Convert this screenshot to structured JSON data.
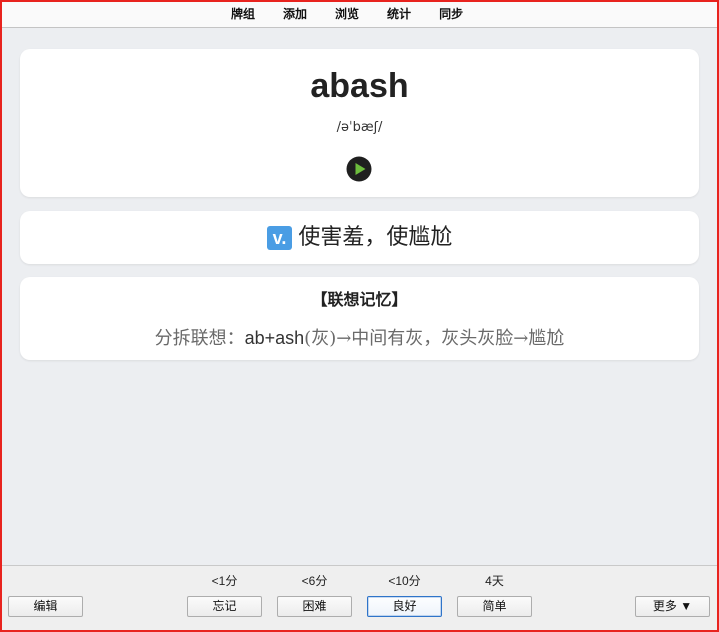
{
  "toolbar": {
    "items": [
      {
        "label": "牌组"
      },
      {
        "label": "添加"
      },
      {
        "label": "浏览"
      },
      {
        "label": "统计"
      },
      {
        "label": "同步"
      }
    ]
  },
  "card": {
    "front": {
      "word": "abash",
      "phonetic": "/əˈbæʃ/",
      "audio_icon": "play-audio-icon"
    },
    "definition": {
      "part_of_speech": "v.",
      "meaning": "使害羞，使尴尬"
    },
    "memory": {
      "heading": "【联想记忆】",
      "segments": [
        "分拆联想：",
        "ab+ash",
        "(灰)→中间有灰，灰头灰脸→尴尬"
      ]
    }
  },
  "answer_bar": {
    "edit_label": "编辑",
    "ease_buttons": [
      {
        "interval": "<1分",
        "label": "忘记",
        "focused": false
      },
      {
        "interval": "<6分",
        "label": "困难",
        "focused": false
      },
      {
        "interval": "<10分",
        "label": "良好",
        "focused": true
      },
      {
        "interval": "4天",
        "label": "简单",
        "focused": false
      }
    ],
    "more_label": "更多 ▼"
  },
  "colors": {
    "frame_border": "#e8231e",
    "app_background": "#eceef1",
    "pos_badge": "#4a9de4",
    "play_button": "#1f1f1f",
    "play_triangle": "#6dbd3d",
    "focus_border": "#2f74c9"
  }
}
